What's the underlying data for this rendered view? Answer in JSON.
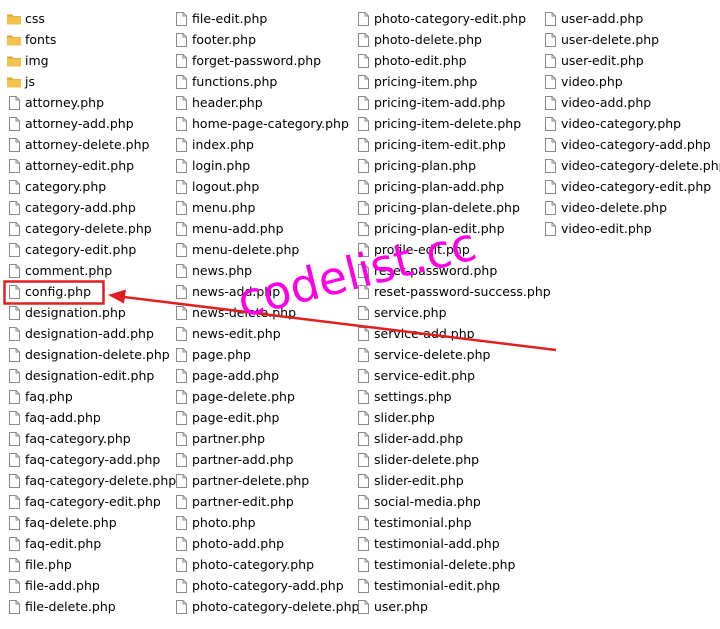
{
  "icons": {
    "folder": "folder-icon",
    "file": "php-file-icon"
  },
  "colors": {
    "folder": "#f3c24e",
    "folder_dark": "#d9a52c",
    "highlight": "#e02020",
    "watermark": "#ff00e6"
  },
  "columns": [
    {
      "items": [
        {
          "label": "css",
          "type": "folder"
        },
        {
          "label": "fonts",
          "type": "folder"
        },
        {
          "label": "img",
          "type": "folder"
        },
        {
          "label": "js",
          "type": "folder"
        },
        {
          "label": "attorney.php",
          "type": "file"
        },
        {
          "label": "attorney-add.php",
          "type": "file"
        },
        {
          "label": "attorney-delete.php",
          "type": "file"
        },
        {
          "label": "attorney-edit.php",
          "type": "file"
        },
        {
          "label": "category.php",
          "type": "file"
        },
        {
          "label": "category-add.php",
          "type": "file"
        },
        {
          "label": "category-delete.php",
          "type": "file"
        },
        {
          "label": "category-edit.php",
          "type": "file"
        },
        {
          "label": "comment.php",
          "type": "file"
        },
        {
          "label": "config.php",
          "type": "file",
          "highlighted": true
        },
        {
          "label": "designation.php",
          "type": "file"
        },
        {
          "label": "designation-add.php",
          "type": "file"
        },
        {
          "label": "designation-delete.php",
          "type": "file"
        },
        {
          "label": "designation-edit.php",
          "type": "file"
        },
        {
          "label": "faq.php",
          "type": "file"
        },
        {
          "label": "faq-add.php",
          "type": "file"
        },
        {
          "label": "faq-category.php",
          "type": "file"
        },
        {
          "label": "faq-category-add.php",
          "type": "file"
        },
        {
          "label": "faq-category-delete.php",
          "type": "file"
        },
        {
          "label": "faq-category-edit.php",
          "type": "file"
        },
        {
          "label": "faq-delete.php",
          "type": "file"
        },
        {
          "label": "faq-edit.php",
          "type": "file"
        },
        {
          "label": "file.php",
          "type": "file"
        },
        {
          "label": "file-add.php",
          "type": "file"
        },
        {
          "label": "file-delete.php",
          "type": "file"
        }
      ]
    },
    {
      "items": [
        {
          "label": "file-edit.php",
          "type": "file"
        },
        {
          "label": "footer.php",
          "type": "file"
        },
        {
          "label": "forget-password.php",
          "type": "file"
        },
        {
          "label": "functions.php",
          "type": "file"
        },
        {
          "label": "header.php",
          "type": "file"
        },
        {
          "label": "home-page-category.php",
          "type": "file"
        },
        {
          "label": "index.php",
          "type": "file"
        },
        {
          "label": "login.php",
          "type": "file"
        },
        {
          "label": "logout.php",
          "type": "file"
        },
        {
          "label": "menu.php",
          "type": "file"
        },
        {
          "label": "menu-add.php",
          "type": "file"
        },
        {
          "label": "menu-delete.php",
          "type": "file"
        },
        {
          "label": "news.php",
          "type": "file"
        },
        {
          "label": "news-add.php",
          "type": "file"
        },
        {
          "label": "news-delete.php",
          "type": "file"
        },
        {
          "label": "news-edit.php",
          "type": "file"
        },
        {
          "label": "page.php",
          "type": "file"
        },
        {
          "label": "page-add.php",
          "type": "file"
        },
        {
          "label": "page-delete.php",
          "type": "file"
        },
        {
          "label": "page-edit.php",
          "type": "file"
        },
        {
          "label": "partner.php",
          "type": "file"
        },
        {
          "label": "partner-add.php",
          "type": "file"
        },
        {
          "label": "partner-delete.php",
          "type": "file"
        },
        {
          "label": "partner-edit.php",
          "type": "file"
        },
        {
          "label": "photo.php",
          "type": "file"
        },
        {
          "label": "photo-add.php",
          "type": "file"
        },
        {
          "label": "photo-category.php",
          "type": "file"
        },
        {
          "label": "photo-category-add.php",
          "type": "file"
        },
        {
          "label": "photo-category-delete.php",
          "type": "file"
        }
      ]
    },
    {
      "items": [
        {
          "label": "photo-category-edit.php",
          "type": "file"
        },
        {
          "label": "photo-delete.php",
          "type": "file"
        },
        {
          "label": "photo-edit.php",
          "type": "file"
        },
        {
          "label": "pricing-item.php",
          "type": "file"
        },
        {
          "label": "pricing-item-add.php",
          "type": "file"
        },
        {
          "label": "pricing-item-delete.php",
          "type": "file"
        },
        {
          "label": "pricing-item-edit.php",
          "type": "file"
        },
        {
          "label": "pricing-plan.php",
          "type": "file"
        },
        {
          "label": "pricing-plan-add.php",
          "type": "file"
        },
        {
          "label": "pricing-plan-delete.php",
          "type": "file"
        },
        {
          "label": "pricing-plan-edit.php",
          "type": "file"
        },
        {
          "label": "profile-edit.php",
          "type": "file"
        },
        {
          "label": "reset-password.php",
          "type": "file"
        },
        {
          "label": "reset-password-success.php",
          "type": "file"
        },
        {
          "label": "service.php",
          "type": "file"
        },
        {
          "label": "service-add.php",
          "type": "file"
        },
        {
          "label": "service-delete.php",
          "type": "file"
        },
        {
          "label": "service-edit.php",
          "type": "file"
        },
        {
          "label": "settings.php",
          "type": "file"
        },
        {
          "label": "slider.php",
          "type": "file"
        },
        {
          "label": "slider-add.php",
          "type": "file"
        },
        {
          "label": "slider-delete.php",
          "type": "file"
        },
        {
          "label": "slider-edit.php",
          "type": "file"
        },
        {
          "label": "social-media.php",
          "type": "file"
        },
        {
          "label": "testimonial.php",
          "type": "file"
        },
        {
          "label": "testimonial-add.php",
          "type": "file"
        },
        {
          "label": "testimonial-delete.php",
          "type": "file"
        },
        {
          "label": "testimonial-edit.php",
          "type": "file"
        },
        {
          "label": "user.php",
          "type": "file"
        }
      ]
    },
    {
      "items": [
        {
          "label": "user-add.php",
          "type": "file"
        },
        {
          "label": "user-delete.php",
          "type": "file"
        },
        {
          "label": "user-edit.php",
          "type": "file"
        },
        {
          "label": "video.php",
          "type": "file"
        },
        {
          "label": "video-add.php",
          "type": "file"
        },
        {
          "label": "video-category.php",
          "type": "file"
        },
        {
          "label": "video-category-add.php",
          "type": "file"
        },
        {
          "label": "video-category-delete.php",
          "type": "file"
        },
        {
          "label": "video-category-edit.php",
          "type": "file"
        },
        {
          "label": "video-delete.php",
          "type": "file"
        },
        {
          "label": "video-edit.php",
          "type": "file"
        }
      ]
    }
  ],
  "watermark": {
    "text": "codelist.cc"
  }
}
